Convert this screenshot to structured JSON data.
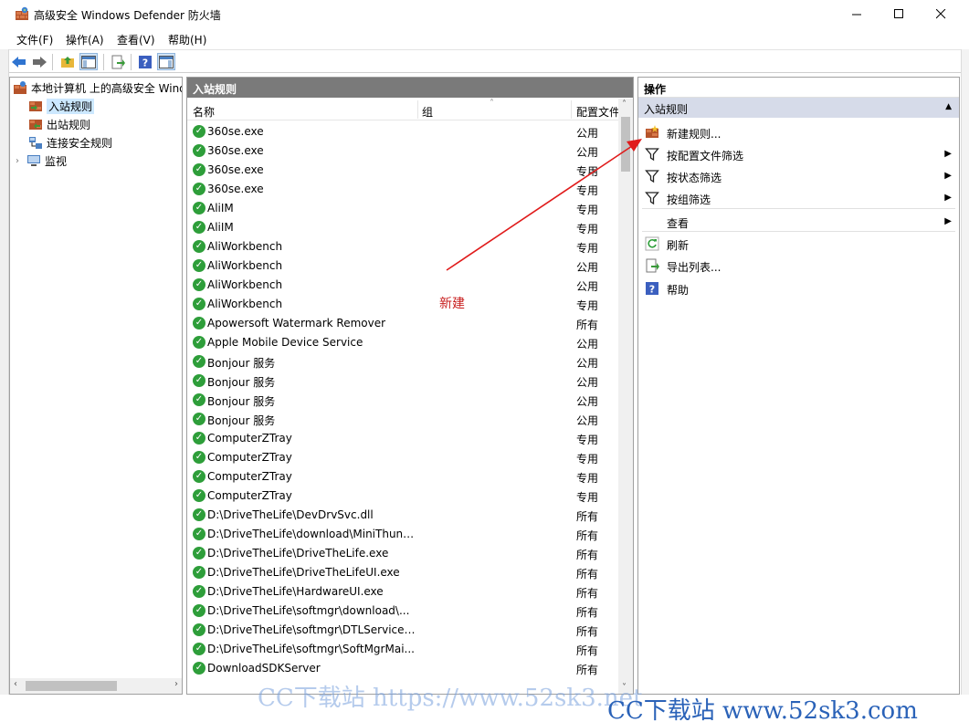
{
  "window": {
    "title": "高级安全 Windows Defender 防火墙",
    "icon": "firewall-icon"
  },
  "menu": [
    "文件(F)",
    "操作(A)",
    "查看(V)",
    "帮助(H)"
  ],
  "tree": {
    "root": "本地计算机 上的高级安全 Windows Defender 防火墙",
    "items": [
      "入站规则",
      "出站规则",
      "连接安全规则",
      "监视"
    ]
  },
  "center": {
    "title": "入站规则",
    "columns": {
      "name": "名称",
      "group": "组",
      "profile": "配置文件"
    },
    "rows": [
      {
        "name": "360se.exe",
        "profile": "公用"
      },
      {
        "name": "360se.exe",
        "profile": "公用"
      },
      {
        "name": "360se.exe",
        "profile": "专用"
      },
      {
        "name": "360se.exe",
        "profile": "专用"
      },
      {
        "name": "AliIM",
        "profile": "专用"
      },
      {
        "name": "AliIM",
        "profile": "专用"
      },
      {
        "name": "AliWorkbench",
        "profile": "专用"
      },
      {
        "name": "AliWorkbench",
        "profile": "公用"
      },
      {
        "name": "AliWorkbench",
        "profile": "公用"
      },
      {
        "name": "AliWorkbench",
        "profile": "专用"
      },
      {
        "name": "Apowersoft Watermark Remover",
        "profile": "所有"
      },
      {
        "name": "Apple Mobile Device Service",
        "profile": "公用"
      },
      {
        "name": "Bonjour 服务",
        "profile": "公用"
      },
      {
        "name": "Bonjour 服务",
        "profile": "公用"
      },
      {
        "name": "Bonjour 服务",
        "profile": "公用"
      },
      {
        "name": "Bonjour 服务",
        "profile": "公用"
      },
      {
        "name": "ComputerZTray",
        "profile": "专用"
      },
      {
        "name": "ComputerZTray",
        "profile": "专用"
      },
      {
        "name": "ComputerZTray",
        "profile": "专用"
      },
      {
        "name": "ComputerZTray",
        "profile": "专用"
      },
      {
        "name": "D:\\DriveTheLife\\DevDrvSvc.dll",
        "profile": "所有"
      },
      {
        "name": "D:\\DriveTheLife\\download\\MiniThund...",
        "profile": "所有"
      },
      {
        "name": "D:\\DriveTheLife\\DriveTheLife.exe",
        "profile": "所有"
      },
      {
        "name": "D:\\DriveTheLife\\DriveTheLifeUI.exe",
        "profile": "所有"
      },
      {
        "name": "D:\\DriveTheLife\\HardwareUI.exe",
        "profile": "所有"
      },
      {
        "name": "D:\\DriveTheLife\\softmgr\\download\\...",
        "profile": "所有"
      },
      {
        "name": "D:\\DriveTheLife\\softmgr\\DTLService.e...",
        "profile": "所有"
      },
      {
        "name": "D:\\DriveTheLife\\softmgr\\SoftMgrMai...",
        "profile": "所有"
      },
      {
        "name": "DownloadSDKServer",
        "profile": "所有"
      }
    ]
  },
  "actions": {
    "header": "操作",
    "section": "入站规则",
    "items": [
      {
        "label": "新建规则...",
        "icon": "new-rule-icon",
        "submenu": false
      },
      {
        "label": "按配置文件筛选",
        "icon": "filter-icon",
        "submenu": true
      },
      {
        "label": "按状态筛选",
        "icon": "filter-icon",
        "submenu": true
      },
      {
        "label": "按组筛选",
        "icon": "filter-icon",
        "submenu": true
      },
      {
        "label": "查看",
        "icon": "",
        "submenu": true
      },
      {
        "label": "刷新",
        "icon": "refresh-icon",
        "submenu": false
      },
      {
        "label": "导出列表...",
        "icon": "export-icon",
        "submenu": false
      },
      {
        "label": "帮助",
        "icon": "help-icon",
        "submenu": false
      }
    ]
  },
  "annotation": {
    "text": "新建",
    "color": "#d00000"
  },
  "watermark": {
    "text1": "CC下载站 https://www.52sk3.net",
    "text2": "CC下载站 www.52sk3.com"
  },
  "colors": {
    "selection": "#cce8ff",
    "panel_header": "#7a7a7a",
    "action_section": "#d6dbe9",
    "rule_enabled": "#2e9e3a"
  }
}
